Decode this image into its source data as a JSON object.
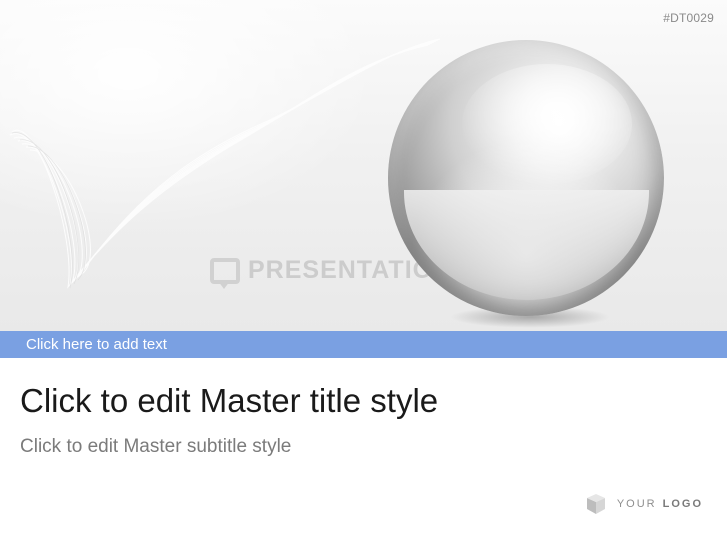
{
  "slide": {
    "id_label": "#DT0029",
    "band_text": "Click here to add text",
    "title": "Click to edit Master title style",
    "subtitle": "Click to edit Master subtitle style",
    "watermark_text": "PRESENTATIONLOAD",
    "logo": {
      "word1": "YOUR",
      "word2": "LOGO"
    }
  },
  "colors": {
    "band": "#7aa0e2",
    "title": "#1a1a1a",
    "subtitle": "#7b7b7b"
  },
  "icons": [
    "chrome-sphere-graphic",
    "wave-lines-graphic",
    "watermark-logo-icon",
    "logo-mark-icon"
  ]
}
